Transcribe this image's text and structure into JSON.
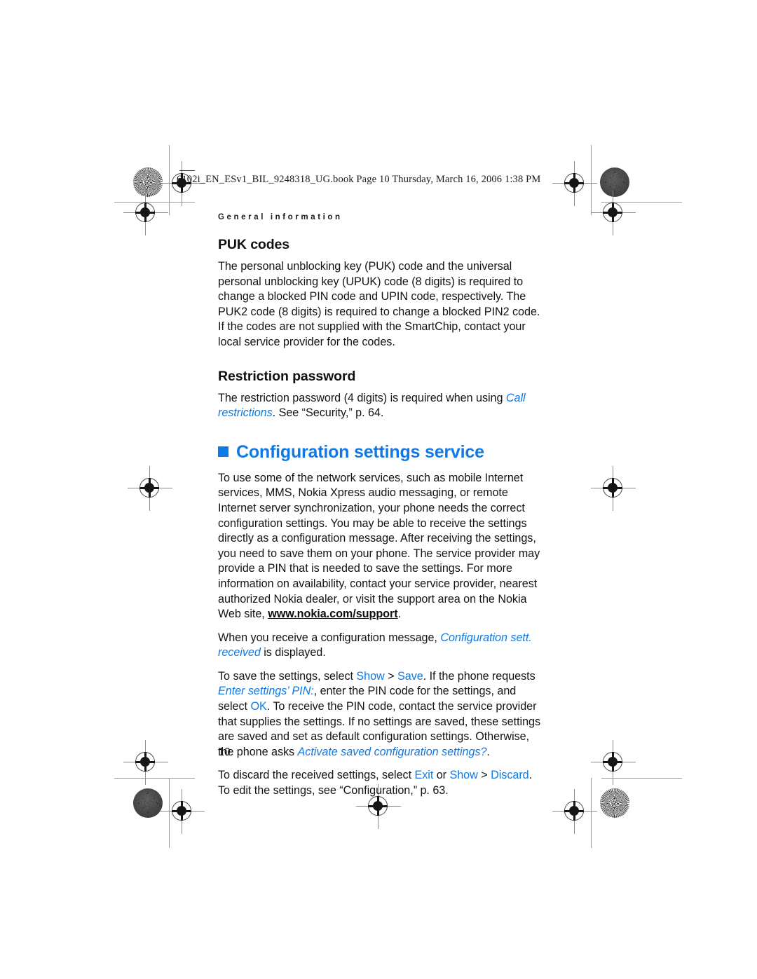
{
  "book_header": {
    "text": "6102i_EN_ESv1_BIL_9248318_UG.book  Page 10  Thursday, March 16, 2006  1:38 PM"
  },
  "colors": {
    "accent_blue": "#0f7ae5",
    "body_text": "#141414",
    "page_background": "#ffffff"
  },
  "content": {
    "running_head": "General information",
    "puk": {
      "heading": "PUK codes",
      "paragraph": "The personal unblocking key (PUK) code and the universal personal unblocking key (UPUK) code (8 digits) is required to change a blocked PIN code and UPIN code, respectively. The PUK2 code (8 digits) is required to change a blocked PIN2 code. If the codes are not supplied with the SmartChip, contact your local service provider for the codes."
    },
    "restriction": {
      "heading": "Restriction password",
      "text_before": "The restriction password (4 digits) is required when using ",
      "ui_italic": "Call restrictions",
      "text_after": ". See “Security,” p. 64."
    },
    "chapter": {
      "bullet": "square-bullet",
      "title": "Configuration settings service"
    },
    "paragraphs": {
      "intro_a": "To use some of the network services, such as mobile Internet services, MMS, Nokia Xpress audio messaging, or remote Internet server synchronization, your phone needs the correct configuration settings. You may be able to receive the settings directly as a configuration message. After receiving the settings, you need to save them on your phone. The service provider may provide a PIN that is needed to save the settings. For more information on availability, contact your service provider, nearest authorized Nokia dealer, or visit the support area on the Nokia Web site, ",
      "intro_url": "www.nokia.com/support",
      "intro_b": ".",
      "received_a": "When you receive a configuration message, ",
      "received_ui": "Configuration sett. received",
      "received_b": " is displayed.",
      "save_a": "To save the settings, select ",
      "save_ui_show": "Show",
      "save_sep1": " > ",
      "save_ui_save": "Save",
      "save_b": ". If the phone requests ",
      "save_ui_enter": "Enter settings’ PIN:",
      "save_c": ", enter the PIN code for the settings, and select ",
      "save_ui_ok": "OK",
      "save_d": ". To receive the PIN code, contact the service provider that supplies the settings. If no settings are saved, these settings are saved and set as default configuration settings. Otherwise, the phone asks ",
      "save_ui_activate": "Activate saved configuration settings?",
      "save_e": ".",
      "discard_a": "To discard the received settings, select ",
      "discard_ui_exit": "Exit",
      "discard_b": " or ",
      "discard_ui_show": "Show",
      "discard_sep": " > ",
      "discard_ui_discard": "Discard",
      "discard_c": ".",
      "edit": "To edit the settings, see “Configuration,” p. 63."
    },
    "page_number": "10"
  }
}
